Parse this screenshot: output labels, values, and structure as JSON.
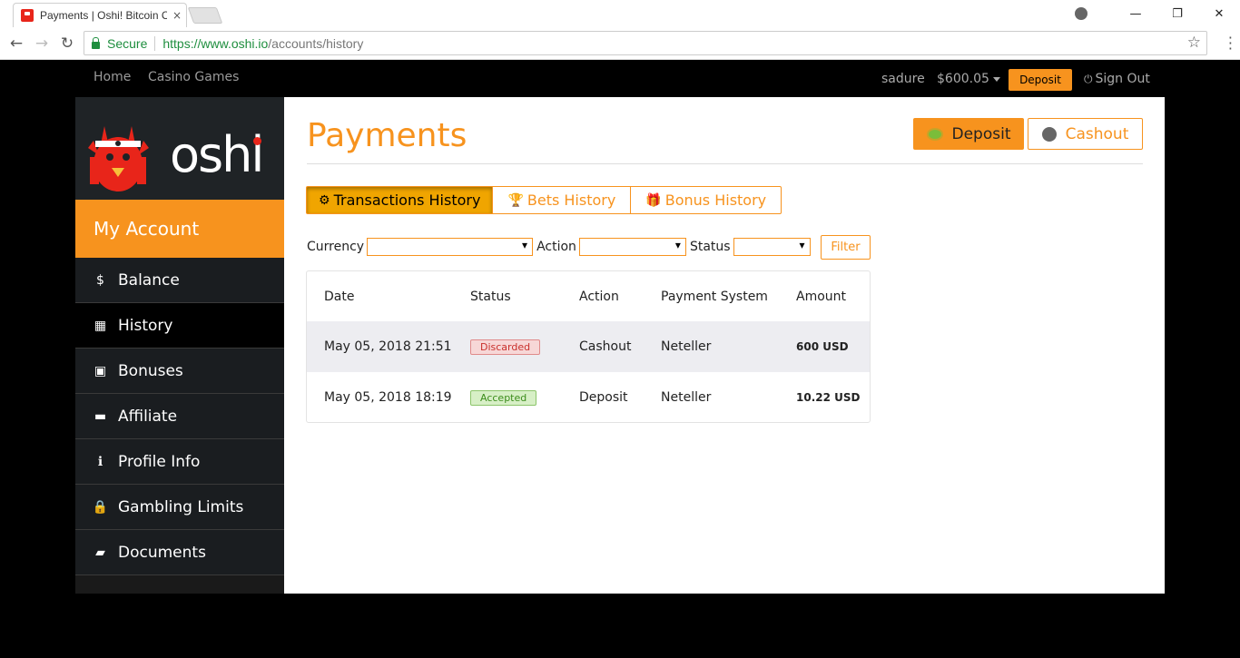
{
  "browser": {
    "tab_title": "Payments | Oshi! Bitcoin C",
    "tab_close": "×",
    "secure_label": "Secure",
    "url_scheme_host": "https://www.oshi.io",
    "url_path": "/accounts/history",
    "back_icon": "←",
    "forward_icon": "→",
    "reload_icon": "↻",
    "star_icon": "☆",
    "minimize": "—",
    "restore": "❐",
    "close": "✕"
  },
  "topnav": {
    "home": "Home",
    "casino_games": "Casino Games",
    "username": "sadure",
    "balance": "$600.05",
    "deposit": "Deposit",
    "sign_out": "Sign Out"
  },
  "sidebar": {
    "logo_text": "oshi",
    "my_account": "My Account",
    "items": [
      {
        "label": "Balance",
        "icon": "$"
      },
      {
        "label": "History",
        "icon": "▦"
      },
      {
        "label": "Bonuses",
        "icon": "▣"
      },
      {
        "label": "Affiliate",
        "icon": "▬"
      },
      {
        "label": "Profile Info",
        "icon": "ℹ"
      },
      {
        "label": "Gambling Limits",
        "icon": "🔒"
      },
      {
        "label": "Documents",
        "icon": "▰"
      }
    ]
  },
  "main": {
    "title": "Payments",
    "deposit_btn": "Deposit",
    "cashout_btn": "Cashout",
    "tabs": [
      {
        "label": "Transactions History",
        "icon": "⚙"
      },
      {
        "label": "Bets History",
        "icon": "🏆"
      },
      {
        "label": "Bonus History",
        "icon": "🎁"
      }
    ],
    "filters": {
      "currency_label": "Currency",
      "action_label": "Action",
      "status_label": "Status",
      "currency_value": "",
      "action_value": "",
      "status_value": "",
      "filter_btn": "Filter"
    },
    "table": {
      "headers": [
        "Date",
        "Status",
        "Action",
        "Payment System",
        "Amount"
      ],
      "rows": [
        {
          "date": "May 05, 2018 21:51",
          "status": "Discarded",
          "action": "Cashout",
          "system": "Neteller",
          "amount": "600 USD"
        },
        {
          "date": "May 05, 2018 18:19",
          "status": "Accepted",
          "action": "Deposit",
          "system": "Neteller",
          "amount": "10.22 USD"
        }
      ]
    }
  },
  "colors": {
    "accent": "#f7931e",
    "sidebar_bg": "#1a1d20",
    "discarded": "#c9302c",
    "accepted": "#3c8d1c"
  }
}
